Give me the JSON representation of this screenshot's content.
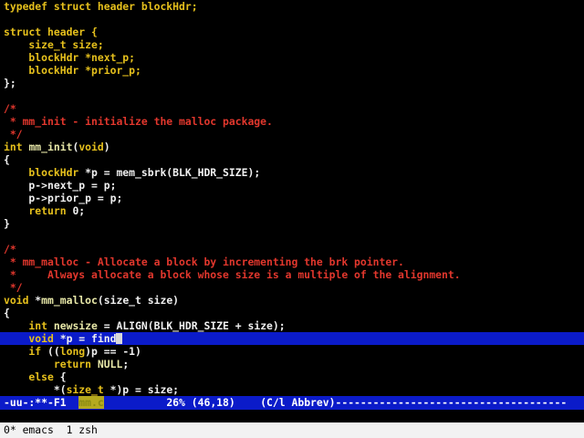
{
  "colors": {
    "default": "#f0f0f0",
    "keyword": "#e6c01c",
    "type": "#e6c01c",
    "function": "#e8e8a8",
    "comment": "#e2372d",
    "constant": "#e8e8a8",
    "highlight": "#0b1bc9",
    "modeline_bg": "#0b1bc9",
    "buffer_name_bg": "#b5aa1f",
    "statusbar_bg": "#f2f2f2"
  },
  "editor": {
    "cursor_line": 26,
    "lines": [
      [
        [
          "typedef struct header blockHdr;",
          "keyword"
        ]
      ],
      [],
      [
        [
          "struct header {",
          "keyword"
        ]
      ],
      [
        [
          "    size_t size;",
          "type"
        ]
      ],
      [
        [
          "    blockHdr *next_p;",
          "type"
        ]
      ],
      [
        [
          "    blockHdr *prior_p;",
          "type"
        ]
      ],
      [
        [
          "};",
          "default"
        ]
      ],
      [],
      [
        [
          "/*",
          "comment"
        ]
      ],
      [
        [
          " * mm_init - initialize the malloc package.",
          "comment"
        ]
      ],
      [
        [
          " */",
          "comment"
        ]
      ],
      [
        [
          "int ",
          "type"
        ],
        [
          "mm_init",
          "function"
        ],
        [
          "(",
          "default"
        ],
        [
          "void",
          "type"
        ],
        [
          ")",
          "default"
        ]
      ],
      [
        [
          "{",
          "default"
        ]
      ],
      [
        [
          "    blockHdr ",
          "type"
        ],
        [
          "*p = mem_sbrk(BLK_HDR_SIZE);",
          "default"
        ]
      ],
      [
        [
          "    p->next_p = p;",
          "default"
        ]
      ],
      [
        [
          "    p->prior_p = p;",
          "default"
        ]
      ],
      [
        [
          "    return ",
          "keyword"
        ],
        [
          "0;",
          "default"
        ]
      ],
      [
        [
          "}",
          "default"
        ]
      ],
      [],
      [
        [
          "/*",
          "comment"
        ]
      ],
      [
        [
          " * mm_malloc - Allocate a block by incrementing the brk pointer.",
          "comment"
        ]
      ],
      [
        [
          " *     Always allocate a block whose size is a multiple of the alignment.",
          "comment"
        ]
      ],
      [
        [
          " */",
          "comment"
        ]
      ],
      [
        [
          "void ",
          "type"
        ],
        [
          "*",
          "default"
        ],
        [
          "mm_malloc",
          "function"
        ],
        [
          "(size_t size)",
          "default"
        ]
      ],
      [
        [
          "{",
          "default"
        ]
      ],
      [
        [
          "    int ",
          "type"
        ],
        [
          "newsize",
          "function"
        ],
        [
          " = ALIGN(BLK_HDR_SIZE + size);",
          "default"
        ]
      ],
      [
        [
          "    void ",
          "type"
        ],
        [
          "*p = find",
          "default"
        ]
      ],
      [
        [
          "    if ",
          "keyword"
        ],
        [
          "((",
          "default"
        ],
        [
          "long",
          "type"
        ],
        [
          ")p == -1)",
          "default"
        ]
      ],
      [
        [
          "        return ",
          "keyword"
        ],
        [
          "NULL",
          "constant"
        ],
        [
          ";",
          "default"
        ]
      ],
      [
        [
          "    else ",
          "keyword"
        ],
        [
          "{",
          "default"
        ]
      ],
      [
        [
          "        *(",
          "default"
        ],
        [
          "size_t ",
          "type"
        ],
        [
          "*)p = size;",
          "default"
        ]
      ]
    ]
  },
  "modeline": {
    "prefix": "-uu-:**-F1  ",
    "buffer": "mm.c",
    "position": "26% (46,18)",
    "mode": "(C/l Abbrev)",
    "fill": "-------------------------------------"
  },
  "statusbar": {
    "text": "0* emacs  1 zsh"
  }
}
